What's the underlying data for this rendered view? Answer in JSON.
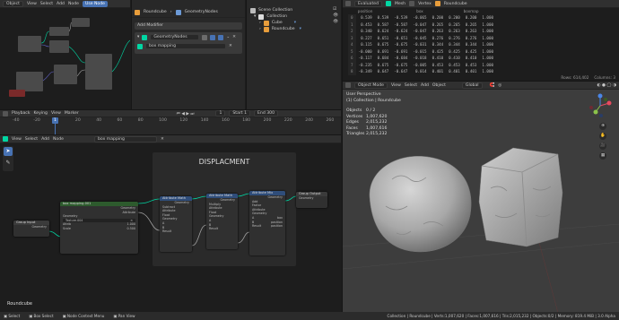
{
  "topbar": {
    "mode": "Object",
    "menus": [
      "View",
      "Select",
      "Add",
      "Node"
    ],
    "use_nodes": "Use Node"
  },
  "properties": {
    "crumb_object": "Roundcube",
    "crumb_modifier": "GeometryNodes",
    "add_modifier": "Add Modifier",
    "modifier_name": "GeometryNodes",
    "node_group": "box mapping"
  },
  "outliner": {
    "title": "Scene Collection",
    "items": [
      "Collection",
      "Cube",
      "Roundcube"
    ]
  },
  "spreadsheet": {
    "header": {
      "mode": "Evaluated",
      "data": "Mesh",
      "domain": "Vertex",
      "object": "Roundcube"
    },
    "columns": [
      "",
      "position",
      "",
      "",
      "box",
      "",
      "",
      "boxmap",
      ""
    ],
    "rows": [
      [
        "0",
        "0.539",
        "0.539",
        "-0.539",
        "-0.065",
        "0.200",
        "0.200",
        "0.200",
        "1.000"
      ],
      [
        "1",
        "0.453",
        "0.587",
        "-0.587",
        "-0.047",
        "0.265",
        "0.265",
        "0.265",
        "1.000"
      ],
      [
        "2",
        "0.340",
        "0.624",
        "-0.624",
        "-0.047",
        "0.263",
        "0.263",
        "0.263",
        "1.000"
      ],
      [
        "3",
        "0.227",
        "0.651",
        "-0.651",
        "-0.045",
        "0.276",
        "0.276",
        "0.276",
        "1.000"
      ],
      [
        "4",
        "0.115",
        "0.675",
        "-0.675",
        "-0.031",
        "0.344",
        "0.344",
        "0.344",
        "1.000"
      ],
      [
        "5",
        "-0.000",
        "0.691",
        "-0.691",
        "-0.015",
        "0.425",
        "0.425",
        "0.425",
        "1.000"
      ],
      [
        "6",
        "-0.117",
        "0.684",
        "-0.684",
        "-0.018",
        "0.410",
        "0.410",
        "0.410",
        "1.000"
      ],
      [
        "7",
        "-0.235",
        "0.675",
        "-0.675",
        "-0.005",
        "0.453",
        "0.453",
        "0.453",
        "1.000"
      ],
      [
        "8",
        "-0.349",
        "0.647",
        "-0.647",
        "0.014",
        "0.401",
        "0.401",
        "0.401",
        "1.000"
      ]
    ],
    "footer_rows": "Rows: 614,402",
    "footer_cols": "Columns: 3"
  },
  "timeline": {
    "menus": [
      "Playback",
      "Keying",
      "View",
      "Marker"
    ],
    "ticks": [
      "-40",
      "-20",
      "0",
      "20",
      "40",
      "60",
      "80",
      "100",
      "120",
      "140",
      "160",
      "180",
      "200",
      "220",
      "240",
      "260"
    ],
    "current": "1",
    "start_label": "Start",
    "start": "1",
    "end_label": "End",
    "end": "300"
  },
  "node_editor": {
    "menus": [
      "View",
      "Select",
      "Add",
      "Node"
    ],
    "tree": "box mapping",
    "frame_label": "DISPLACMENT",
    "object_name": "Roundcube",
    "nodes": {
      "group_input": {
        "title": "Group Input",
        "rows": [
          "Geometry"
        ]
      },
      "box_mapping": {
        "title": "box mapping.001",
        "rows": [
          "Geometry",
          "Attribute",
          "Geometry",
          "Texture.004",
          "Attrib",
          "Scale"
        ],
        "values": {
          "strength": "1.000",
          "scale": "0.500"
        }
      },
      "attr_math1": {
        "title": "Attribute Math",
        "rows": [
          "Geometry",
          "Subtract",
          "Attribute",
          "Float",
          "Geometry",
          "A",
          "B",
          "Result"
        ]
      },
      "attr_math2": {
        "title": "Attribute Math",
        "rows": [
          "Geometry",
          "Multiply",
          "Attribute",
          "Float",
          "Geometry",
          "A",
          "B",
          "Result"
        ]
      },
      "attr_mix": {
        "title": "Attribute Mix",
        "rows": [
          "Geometry",
          "Add",
          "Factor",
          "Attribute",
          "Geometry",
          "A",
          "B",
          "Result"
        ],
        "values": {
          "a": "box",
          "b": "position",
          "result": "position"
        }
      },
      "group_output": {
        "title": "Group Output",
        "rows": [
          "Geometry"
        ]
      }
    }
  },
  "viewport": {
    "menus": [
      "Object Mode",
      "View",
      "Select",
      "Add",
      "Object"
    ],
    "transform": "Global",
    "perspective": "User Perspective",
    "collection": "(1) Collection | Roundcube",
    "stats": [
      [
        "Objects",
        "0 / 2"
      ],
      [
        "Vertices",
        "1,007,620"
      ],
      [
        "Edges",
        "2,015,232"
      ],
      [
        "Faces",
        "1,007,616"
      ],
      [
        "Triangles",
        "2,015,232"
      ]
    ]
  },
  "statusbar": {
    "left": [
      "Select",
      "Box Select",
      "Node Context Menu",
      "Pan View"
    ],
    "right": "Collection | Roundcube | Verts:1,007,620 | Faces:1,007,616 | Tris:2,015,232 | Objects:0/2 | Memory: 819.4 MiB | 3.0 Alpha"
  },
  "colors": {
    "accent": "#4772b3",
    "geometry_socket": "#00d6a3",
    "float_socket": "#a1a1a1",
    "vector_socket": "#6363c7"
  }
}
